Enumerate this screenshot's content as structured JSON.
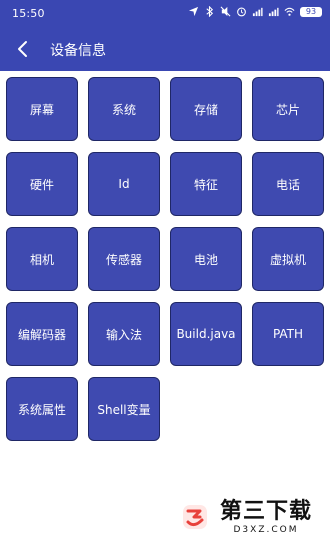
{
  "status_bar": {
    "time": "15:50",
    "battery": "93",
    "icons": [
      "location-icon",
      "bluetooth-icon",
      "mute-icon",
      "alarm-icon",
      "signal-icon",
      "signal-icon",
      "wifi-icon"
    ]
  },
  "header": {
    "title": "设备信息",
    "back_icon": "back-arrow-icon",
    "background": "#3a47b2"
  },
  "tiles": [
    "屏幕",
    "系统",
    "存储",
    "芯片",
    "硬件",
    "Id",
    "特征",
    "电话",
    "相机",
    "传感器",
    "电池",
    "虚拟机",
    "编解码器",
    "输入法",
    "Build.java",
    "PATH",
    "系统属性",
    "Shell变量"
  ],
  "tile_color": "#3f4ab0",
  "watermark": {
    "main": "第三下载",
    "sub": "D3XZ.COM",
    "accent": "#e8413b"
  }
}
